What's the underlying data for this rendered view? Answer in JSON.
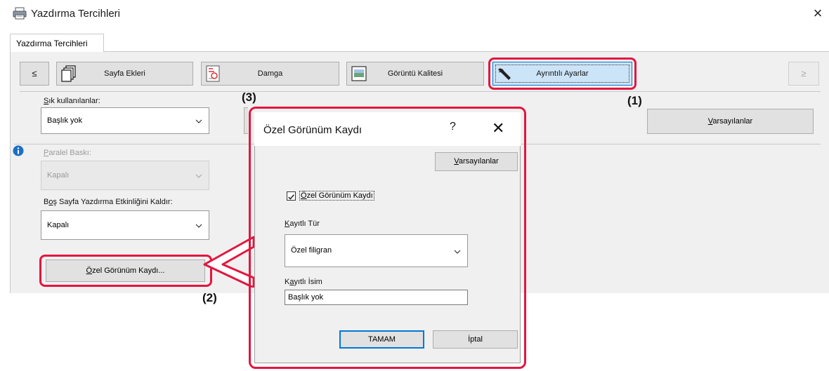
{
  "window": {
    "title": "Yazdırma Tercihleri",
    "close_glyph": "×",
    "tab_label": "Yazdırma Tercihleri"
  },
  "toolbar": {
    "nav_left": "≤",
    "nav_right": "≥",
    "buttons": [
      {
        "label": "Sayfa Ekleri",
        "icon": "pages-icon"
      },
      {
        "label": "Damga",
        "icon": "stamp-icon"
      },
      {
        "label": "Görüntü Kalitesi",
        "icon": "image-quality-icon"
      },
      {
        "label": "Ayrıntılı Ayarlar",
        "icon": "wrench-icon",
        "selected": true
      }
    ]
  },
  "settings": {
    "favorites_label": "Sık kullanılanlar:",
    "favorites_value": "Başlık yok",
    "defaults_button": "Varsayılanlar",
    "parallel_label": "Paralel Baskı:",
    "parallel_value": "Kapalı",
    "blank_page_label": "Boş Sayfa Yazdırma Etkinliğini Kaldır:",
    "blank_page_value": "Kapalı",
    "custom_reg_button": "Özel Görünüm Kaydı..."
  },
  "callouts": {
    "one": "(1)",
    "two": "(2)",
    "three": "(3)"
  },
  "dialog": {
    "title": "Özel Görünüm Kaydı",
    "help": "?",
    "close": "✕",
    "defaults_button": "Varsayılanlar",
    "checkbox_label": "Özel Görünüm Kaydı",
    "checkbox_checked": true,
    "type_label": "Kayıtlı Tür",
    "type_value": "Özel filigran",
    "name_label": "Kayıtlı İsim",
    "name_value": "Başlık yok",
    "ok_button": "TAMAM",
    "cancel_button": "İptal"
  },
  "colors": {
    "highlight": "#e3163f",
    "selected_tab_bg": "#cce4f7",
    "accent": "#0078d7"
  }
}
